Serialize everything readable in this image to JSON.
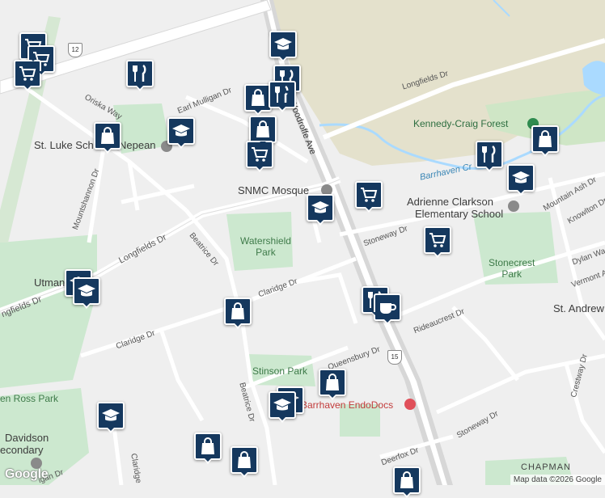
{
  "map": {
    "colors": {
      "land": "#efefef",
      "park": "#cce8cf",
      "forest_land": "#e4e1cc",
      "water": "#aadaff",
      "road": "#ffffff",
      "arterial": "#d6d6d6",
      "pin": "#15385e"
    },
    "labels": {
      "woodroffe": "Woodroffe Ave",
      "longfields_top": "Longfields Dr",
      "longfields_left": "Longfields Dr",
      "longfields_far_left": "ngfields Dr",
      "earl_mulligan": "Earl Mulligan Dr",
      "oriska": "Oriska Way",
      "mountshannon": "Mountshannon Dr",
      "beatrice1": "Beatrice Dr",
      "beatrice2": "Beatrice Dr",
      "claridge1": "Claridge Dr",
      "claridge2": "Claridge Dr",
      "claridge3": "Claridge",
      "stoneway1": "Stoneway Dr",
      "stoneway2": "Stoneway Dr",
      "rideaucrest": "Rideaucrest Dr",
      "queensbury": "Queensbury Dr",
      "deerfox": "Deerfox Dr",
      "mountain_ash": "Mountain Ash Dr",
      "knowlton": "Knowlton Dr",
      "dylan": "Dylan Wa",
      "vermont": "Vermont A",
      "crestway": "Crestway Dr",
      "mulligan_bottom": "igan Dr",
      "road_12": "12",
      "road_15": "15"
    },
    "parks": {
      "watershield": [
        "Watershield",
        "Park"
      ],
      "stonecrest": [
        "Stonecrest",
        "Park"
      ],
      "stinson": "Stinson Park",
      "ben_ross": "en Ross Park"
    },
    "pois": {
      "snmc": "SNMC Mosque",
      "st_luke": "St. Luke Sch",
      "nepean": "Nepean",
      "adrienne_1": "Adrienne Clarkson",
      "adrienne_2": "Elementary School",
      "utman": "Utman",
      "st_andrew": "St. Andrew",
      "davidson_1": "Davidson",
      "davidson_2": "econdary",
      "endodocs": "Barrhaven EndoDocs",
      "kennedy_craig": "Kennedy-Craig Forest",
      "barrhaven_creek": "Barrhaven Cr"
    },
    "area": "CHAPMAN",
    "pins": [
      {
        "name": "shopping-cart",
        "icon": "cart",
        "id": "cart-a"
      },
      {
        "name": "shopping-cart",
        "icon": "cart",
        "id": "cart-b"
      },
      {
        "name": "shopping-cart",
        "icon": "cart",
        "id": "cart-c"
      },
      {
        "name": "school",
        "icon": "school",
        "id": "school-a"
      },
      {
        "name": "restaurant",
        "icon": "restaurant",
        "id": "rest-a"
      },
      {
        "name": "restaurant",
        "icon": "restaurant",
        "id": "rest-b"
      },
      {
        "name": "shopping-bag",
        "icon": "bag",
        "id": "bag-a"
      },
      {
        "name": "shopping-bag",
        "icon": "bag",
        "id": "bag-b"
      },
      {
        "name": "school",
        "icon": "school",
        "id": "school-b"
      },
      {
        "name": "shopping-bag",
        "icon": "bag",
        "id": "bag-c"
      },
      {
        "name": "shopping-cart",
        "icon": "cart",
        "id": "cart-d"
      },
      {
        "name": "school",
        "icon": "school",
        "id": "school-c"
      },
      {
        "name": "shopping-cart",
        "icon": "cart",
        "id": "cart-e"
      },
      {
        "name": "restaurant",
        "icon": "restaurant",
        "id": "rest-c"
      },
      {
        "name": "shopping-bag",
        "icon": "bag",
        "id": "bag-d"
      },
      {
        "name": "school",
        "icon": "school",
        "id": "school-d"
      },
      {
        "name": "shopping-cart",
        "icon": "cart",
        "id": "cart-f"
      },
      {
        "name": "school",
        "icon": "school",
        "id": "school-e"
      },
      {
        "name": "school",
        "icon": "school",
        "id": "school-f"
      },
      {
        "name": "shopping-bag",
        "icon": "bag",
        "id": "bag-e"
      },
      {
        "name": "restaurant",
        "icon": "restaurant",
        "id": "rest-d"
      },
      {
        "name": "restaurant",
        "icon": "restaurant",
        "id": "rest-e"
      },
      {
        "name": "cafe",
        "icon": "cafe",
        "id": "cafe-a"
      },
      {
        "name": "shopping-bag",
        "icon": "bag",
        "id": "bag-f"
      },
      {
        "name": "school",
        "icon": "school",
        "id": "school-g"
      },
      {
        "name": "school",
        "icon": "school",
        "id": "school-h"
      },
      {
        "name": "school",
        "icon": "school",
        "id": "school-i"
      },
      {
        "name": "shopping-bag",
        "icon": "bag",
        "id": "bag-g"
      },
      {
        "name": "shopping-bag",
        "icon": "bag",
        "id": "bag-h"
      },
      {
        "name": "shopping-bag",
        "icon": "bag",
        "id": "bag-i"
      }
    ],
    "branding": "Google",
    "attribution": "Map data ©2026 Google"
  }
}
